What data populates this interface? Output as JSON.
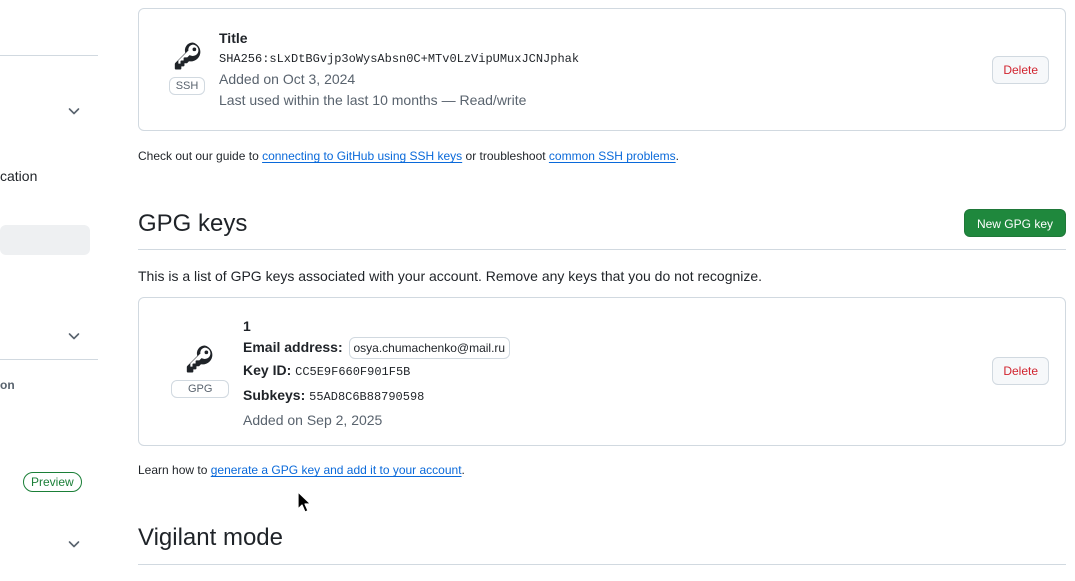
{
  "sidebar": {
    "items": [
      {
        "label": "cation"
      },
      {
        "label": "on"
      }
    ],
    "badge": "Preview"
  },
  "ssh_key": {
    "type": "SSH",
    "title": "Title",
    "fingerprint": "SHA256:sLxDtBGvjp3oWysAbsn0C+MTv0LzVipUMuxJCNJphak",
    "added": "Added on Oct 3, 2024",
    "last_used": "Last used within the last 10 months — Read/write",
    "delete_label": "Delete"
  },
  "ssh_help": {
    "prefix": "Check out our guide to ",
    "link1": "connecting to GitHub using SSH keys",
    "middle": " or troubleshoot ",
    "link2": "common SSH problems",
    "suffix": "."
  },
  "gpg": {
    "heading": "GPG keys",
    "new_button": "New GPG key",
    "description": "This is a list of GPG keys associated with your account. Remove any keys that you do not recognize.",
    "key": {
      "type": "GPG",
      "title": "1",
      "email_label": "Email address:",
      "email": "osya.chumachenko@mail.ru",
      "keyid_label": "Key ID:",
      "keyid": "CC5E9F660F901F5B",
      "subkeys_label": "Subkeys:",
      "subkeys": "55AD8C6B88790598",
      "added": "Added on Sep 2, 2025",
      "delete_label": "Delete"
    },
    "help_prefix": "Learn how to ",
    "help_link": "generate a GPG key and add it to your account",
    "help_suffix": "."
  },
  "vigilant": {
    "heading": "Vigilant mode"
  },
  "icons": {
    "key": "key-icon",
    "chevron": "chevron-down-icon",
    "cursor": "mouse-cursor-icon"
  }
}
